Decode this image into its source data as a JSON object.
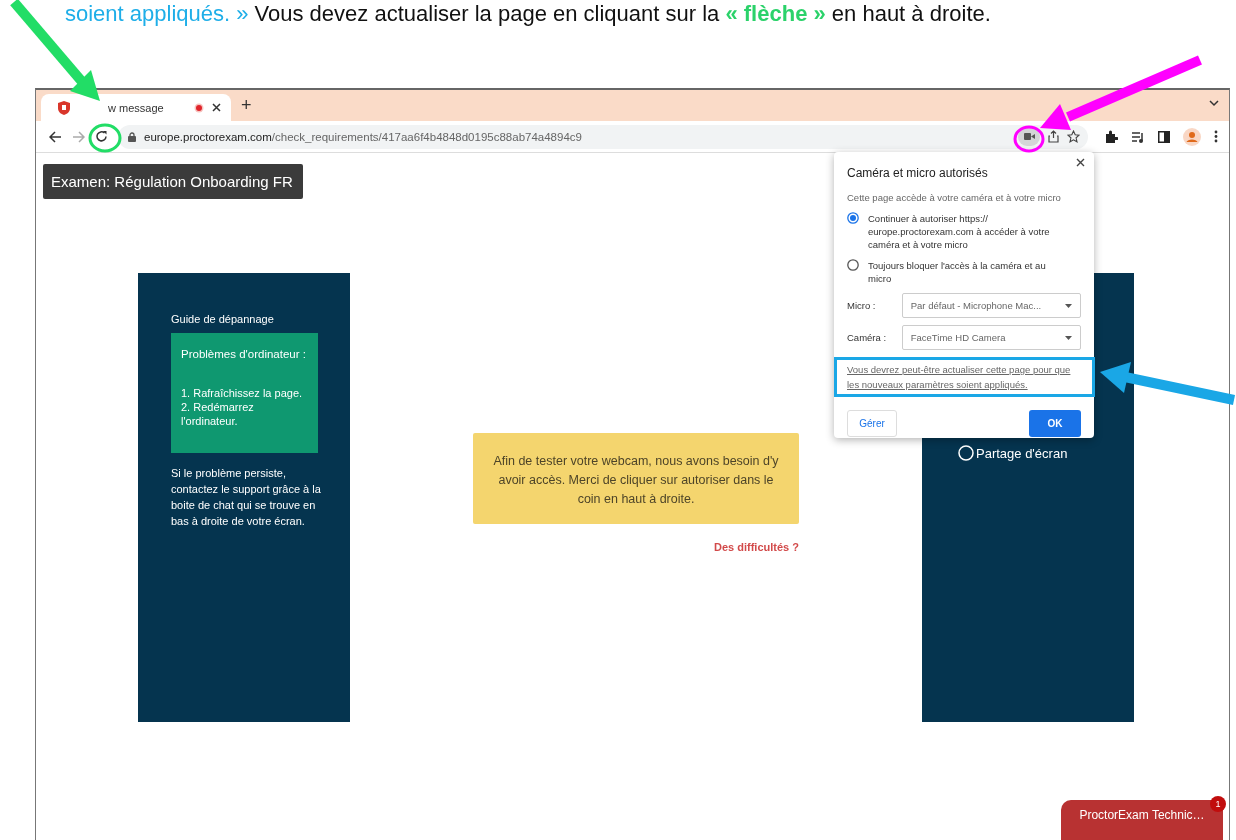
{
  "instruction": {
    "segments": [
      {
        "text": "soient appliqués. »",
        "kind": "quote"
      },
      {
        "text": " Vous devez actualiser la page en cliquant sur la ",
        "kind": "plain"
      },
      {
        "text": "« flèche »",
        "kind": "emphasis"
      },
      {
        "text": " en haut à droite.",
        "kind": "plain"
      }
    ]
  },
  "browser": {
    "tab": {
      "title": "w message",
      "recording": true
    },
    "new_tab": "+",
    "url": {
      "host": "europe.proctorexam.com",
      "path": "/check_requirements/417aa6f4b4848d0195c88ab74a4894c9"
    }
  },
  "page": {
    "exam_title": "Examen: Régulation Onboarding FR",
    "guide": {
      "heading": "Guide de dépannage",
      "box_title": "Problèmes d'ordinateur :",
      "steps": [
        "1. Rafraîchissez la page.",
        "2. Redémarrez l'ordinateur."
      ],
      "note": "Si le problème persiste, contactez le support grâce à la boite de chat qui se trouve en bas à droite de votre écran."
    },
    "notice": "Afin de tester votre webcam, nous avons besoin d'y avoir accès. Merci de cliquer sur autoriser dans le coin en haut à droite.",
    "help_link": "Des difficultés ?",
    "devices": [
      {
        "label": "Partage d'écran",
        "selected": false
      }
    ]
  },
  "popup": {
    "title": "Caméra et micro autorisés",
    "subtitle": "Cette page accède à votre caméra et à votre micro",
    "options": [
      {
        "label": "Continuer à autoriser https:// europe.proctorexam.com à accéder à votre caméra et à votre micro",
        "selected": true
      },
      {
        "label": "Toujours bloquer l'accès à la caméra et au micro",
        "selected": false
      }
    ],
    "selects": [
      {
        "label": "Micro :",
        "value": "Par défaut - Microphone Mac..."
      },
      {
        "label": "Caméra :",
        "value": "FaceTime HD Camera"
      }
    ],
    "note": "Vous devrez peut-être actualiser cette page pour que les nouveaux paramètres soient appliqués.",
    "buttons": [
      {
        "label": "Gérer",
        "kind": "secondary"
      },
      {
        "label": "OK",
        "kind": "primary"
      }
    ]
  },
  "chat": {
    "label": "ProctorExam Technic…",
    "badge": "1"
  }
}
